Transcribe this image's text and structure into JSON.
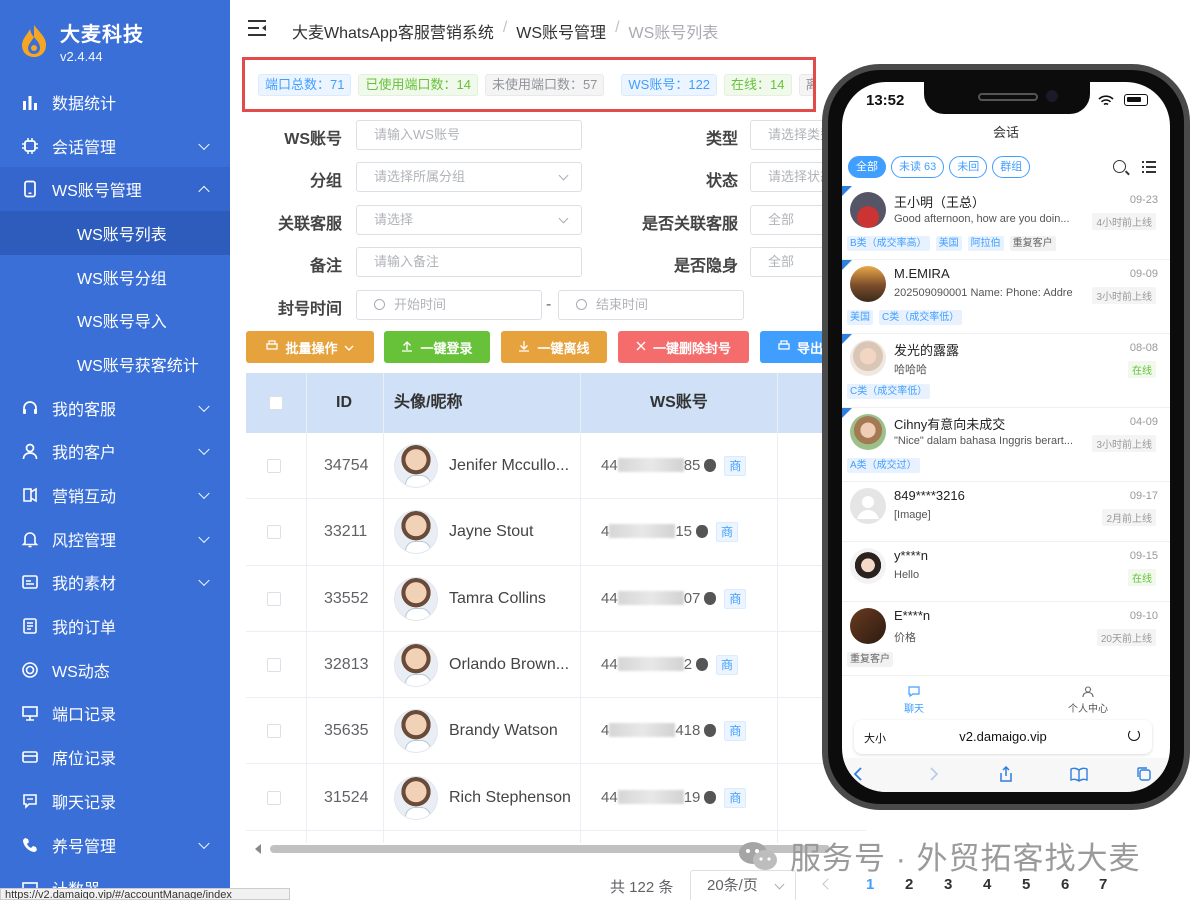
{
  "brand": {
    "name": "大麦科技",
    "version": "v2.4.44"
  },
  "sidebar": {
    "items": [
      {
        "label": "数据统计",
        "icon": "bar-chart-icon",
        "chevron": ""
      },
      {
        "label": "会话管理",
        "icon": "chip-icon",
        "chevron": "down"
      },
      {
        "label": "WS账号管理",
        "icon": "phone-icon",
        "chevron": "up",
        "open": true
      }
    ],
    "subitems": [
      "WS账号列表",
      "WS账号分组",
      "WS账号导入",
      "WS账号获客统计"
    ],
    "items2": [
      {
        "label": "我的客服",
        "icon": "headset-icon",
        "chevron": "down"
      },
      {
        "label": "我的客户",
        "icon": "user-icon",
        "chevron": "down"
      },
      {
        "label": "营销互动",
        "icon": "megaphone-icon",
        "chevron": "down"
      },
      {
        "label": "风控管理",
        "icon": "bell-icon",
        "chevron": "down"
      },
      {
        "label": "我的素材",
        "icon": "media-icon",
        "chevron": "down"
      },
      {
        "label": "我的订单",
        "icon": "document-icon",
        "chevron": ""
      },
      {
        "label": "WS动态",
        "icon": "ring-icon",
        "chevron": ""
      },
      {
        "label": "端口记录",
        "icon": "monitor-icon",
        "chevron": ""
      },
      {
        "label": "席位记录",
        "icon": "card-icon",
        "chevron": ""
      },
      {
        "label": "聊天记录",
        "icon": "chat-icon",
        "chevron": ""
      },
      {
        "label": "养号管理",
        "icon": "phone-call-icon",
        "chevron": "down"
      },
      {
        "label": "计数器",
        "icon": "counter-icon",
        "chevron": ""
      }
    ],
    "status_url": "https://v2.damaigo.vip/#/accountManage/index"
  },
  "breadcrumb": {
    "root": "大麦WhatsApp客服营销系统",
    "mid": "WS账号管理",
    "current": "WS账号列表",
    "sep": "/"
  },
  "stats": {
    "port_total": "端口总数：71",
    "port_used": "已使用端口数：14",
    "port_unused": "未使用端口数：57",
    "ws_accounts": "WS账号：122",
    "online": "在线：14",
    "clipped": "离"
  },
  "form": {
    "ws_label": "WS账号",
    "ws_placeholder": "请输入WS账号",
    "type_label": "类型",
    "type_placeholder": "请选择类型",
    "group_label": "分组",
    "group_placeholder": "请选择所属分组",
    "status_label": "状态",
    "status_placeholder": "请选择状态",
    "agent_label": "关联客服",
    "agent_placeholder": "请选择",
    "linked_label": "是否关联客服",
    "linked_value": "全部",
    "remark_label": "备注",
    "remark_placeholder": "请输入备注",
    "hidden_label": "是否隐身",
    "hidden_value": "全部",
    "ban_label": "封号时间",
    "start_placeholder": "开始时间",
    "end_placeholder": "结束时间",
    "range_sep": "-"
  },
  "actions": {
    "batch": "批量操作",
    "login": "一键登录",
    "offline": "一键离线",
    "unban": "一键删除封号",
    "export": "导出"
  },
  "colors": {
    "sidebar": "#3a6fd8",
    "orange": "#e6a23c",
    "green": "#67c23a",
    "red": "#f56c6c",
    "blue": "#409eff"
  },
  "table": {
    "headers": {
      "id": "ID",
      "avatar": "头像/昵称",
      "ws": "WS账号"
    },
    "rows": [
      {
        "id": "34754",
        "name": "Jenifer Mccullo...",
        "ws_pre": "44",
        "ws_suf": "85",
        "badge": "商"
      },
      {
        "id": "33211",
        "name": "Jayne Stout",
        "ws_pre": "4",
        "ws_suf": "15",
        "badge": "商"
      },
      {
        "id": "33552",
        "name": "Tamra Collins",
        "ws_pre": "44",
        "ws_suf": "07",
        "badge": "商"
      },
      {
        "id": "32813",
        "name": "Orlando Brown...",
        "ws_pre": "44",
        "ws_suf": "2",
        "badge": "商"
      },
      {
        "id": "35635",
        "name": "Brandy Watson",
        "ws_pre": "4",
        "ws_suf": "418",
        "badge": "商"
      },
      {
        "id": "31524",
        "name": "Rich Stephenson",
        "ws_pre": "44",
        "ws_suf": "19",
        "badge": "商"
      }
    ]
  },
  "pagination": {
    "total": "共 122 条",
    "size": "20条/页",
    "pages": [
      "1",
      "2",
      "3",
      "4",
      "5",
      "6",
      "7"
    ],
    "current": "1"
  },
  "watermark": "服务号 · 外贸拓客找大麦",
  "phone": {
    "time": "13:52",
    "title": "会话",
    "tabs": [
      "全部",
      "未读 63",
      "未回",
      "群组"
    ],
    "chats": [
      {
        "name": "王小明（王总）",
        "date": "09-23",
        "msg": "Good afternoon, how are you doin...",
        "status": "4小时前上线",
        "online": false,
        "labels": [
          "B类（成交率高）",
          "美国",
          "阿拉伯",
          "重复客户"
        ]
      },
      {
        "name": "M.EMIRA",
        "date": "09-09",
        "msg": "202509090001 Name: Phone: Addre",
        "status": "3小时前上线",
        "online": false,
        "labels": [
          "美国",
          "C类（成交率低）"
        ]
      },
      {
        "name": "发光的露露",
        "date": "08-08",
        "msg": "哈哈哈",
        "status": "在线",
        "online": true,
        "labels": [
          "C类（成交率低）"
        ]
      },
      {
        "name": "Cihny有意向未成交",
        "date": "04-09",
        "msg": "\"Nice\" dalam bahasa Inggris berart...",
        "status": "3小时前上线",
        "online": false,
        "labels": [
          "A类（成交过）"
        ]
      },
      {
        "name": "849****3216",
        "date": "09-17",
        "msg": "[Image]",
        "status": "2月前上线",
        "online": false,
        "labels": []
      },
      {
        "name": "y****n",
        "date": "09-15",
        "msg": "Hello",
        "status": "在线",
        "online": true,
        "labels": []
      },
      {
        "name": "E****n",
        "date": "09-10",
        "msg": "价格",
        "status": "20天前上线",
        "online": false,
        "labels": [
          "重复客户"
        ]
      }
    ],
    "nav_chat": "聊天",
    "nav_me": "个人中心",
    "url_aa": "大小",
    "url": "v2.damaigo.vip"
  }
}
